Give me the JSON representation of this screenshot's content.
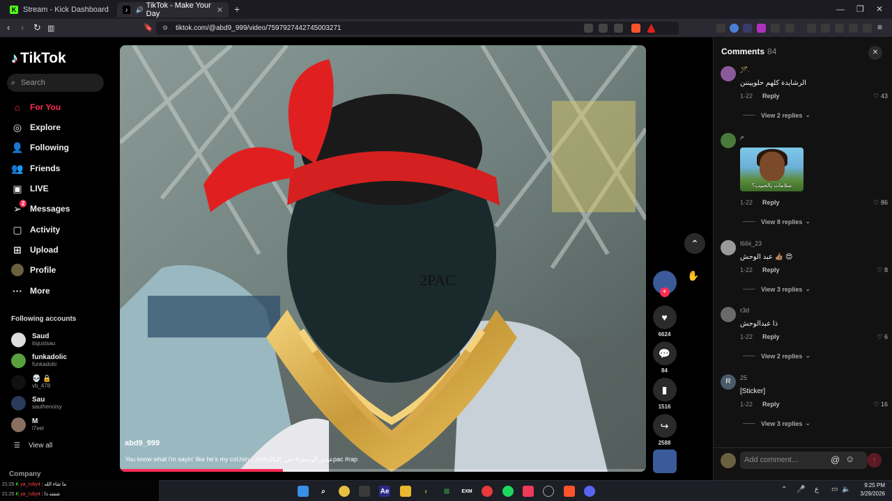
{
  "browser": {
    "tabs": [
      {
        "title": "Stream - Kick Dashboard",
        "active": false
      },
      {
        "title": "TikTok - Make Your Day",
        "active": true
      }
    ],
    "url": "tiktok.com/@abd9_999/video/7597927442745003271"
  },
  "sidebar": {
    "logo": "TikTok",
    "search_placeholder": "Search",
    "nav": [
      {
        "label": "For You",
        "icon": "home-icon",
        "active": true
      },
      {
        "label": "Explore",
        "icon": "compass-icon"
      },
      {
        "label": "Following",
        "icon": "user-follow-icon"
      },
      {
        "label": "Friends",
        "icon": "friends-icon"
      },
      {
        "label": "LIVE",
        "icon": "live-icon"
      },
      {
        "label": "Messages",
        "icon": "send-icon",
        "badge": "2"
      },
      {
        "label": "Activity",
        "icon": "activity-icon"
      },
      {
        "label": "Upload",
        "icon": "plus-square-icon"
      },
      {
        "label": "Profile",
        "icon": "avatar"
      },
      {
        "label": "More",
        "icon": "more-icon"
      }
    ],
    "following_title": "Following accounts",
    "accounts": [
      {
        "name": "Saud",
        "handle": "itsjustsau"
      },
      {
        "name": "funkadolic",
        "handle": "funkadolic"
      },
      {
        "name": "💀 🔒",
        "handle": "vb_478"
      },
      {
        "name": "Sau",
        "handle": "sauthenoisy"
      },
      {
        "name": "M",
        "handle": "l7eel"
      }
    ],
    "view_all": "View all",
    "company": "Company"
  },
  "video": {
    "author": "abd9_999",
    "caption": "You know what i'm sayin' like he's my coUsin ...#عبدو_الوحش# حي_البلالة#2pac #rap",
    "face_text": "2PAC",
    "progress": 0.31
  },
  "actions": {
    "likes": "6624",
    "comments": "84",
    "saves": "1516",
    "shares": "2588"
  },
  "comments_panel": {
    "title": "Comments",
    "count": "84",
    "items": [
      {
        "name": "🪄.",
        "text": "الرشايدة كلهم حلوييننن",
        "date": "1-22",
        "reply": "Reply",
        "likes": "43",
        "view_replies": "View 2 replies"
      },
      {
        "name": "م",
        "sticker_text": "سلامات يالحبيب؟",
        "date": "1-22",
        "reply": "Reply",
        "likes": "86",
        "view_replies": "View 8 replies"
      },
      {
        "name": "l66ii_23",
        "text": "عبد الوحش 👍🏽 😍",
        "date": "1-22",
        "reply": "Reply",
        "likes": "8",
        "view_replies": "View 3 replies"
      },
      {
        "name": "r3d",
        "text": "ذا عبدالوحش",
        "date": "1-22",
        "reply": "Reply",
        "likes": "6",
        "view_replies": "View 2 replies"
      },
      {
        "name": "25",
        "avatar_letter": "R",
        "text": "[Sticker]",
        "date": "1-22",
        "reply": "Reply",
        "likes": "16",
        "view_replies": "View 3 replies"
      }
    ],
    "add_placeholder": "Add comment..."
  },
  "taskbar": {
    "time": "9:25 PM",
    "date": "3/29/2026",
    "lang": "ع",
    "chat": [
      {
        "time": "21:25",
        "user": "ya_ruby4",
        "msg": ": ما شاء الله"
      },
      {
        "time": "21:25",
        "user": "ya_ruby4",
        "msg": ": شفته ذا"
      }
    ]
  },
  "colors": {
    "accent": "#fe2c55",
    "chat_user": "#ff4040"
  }
}
